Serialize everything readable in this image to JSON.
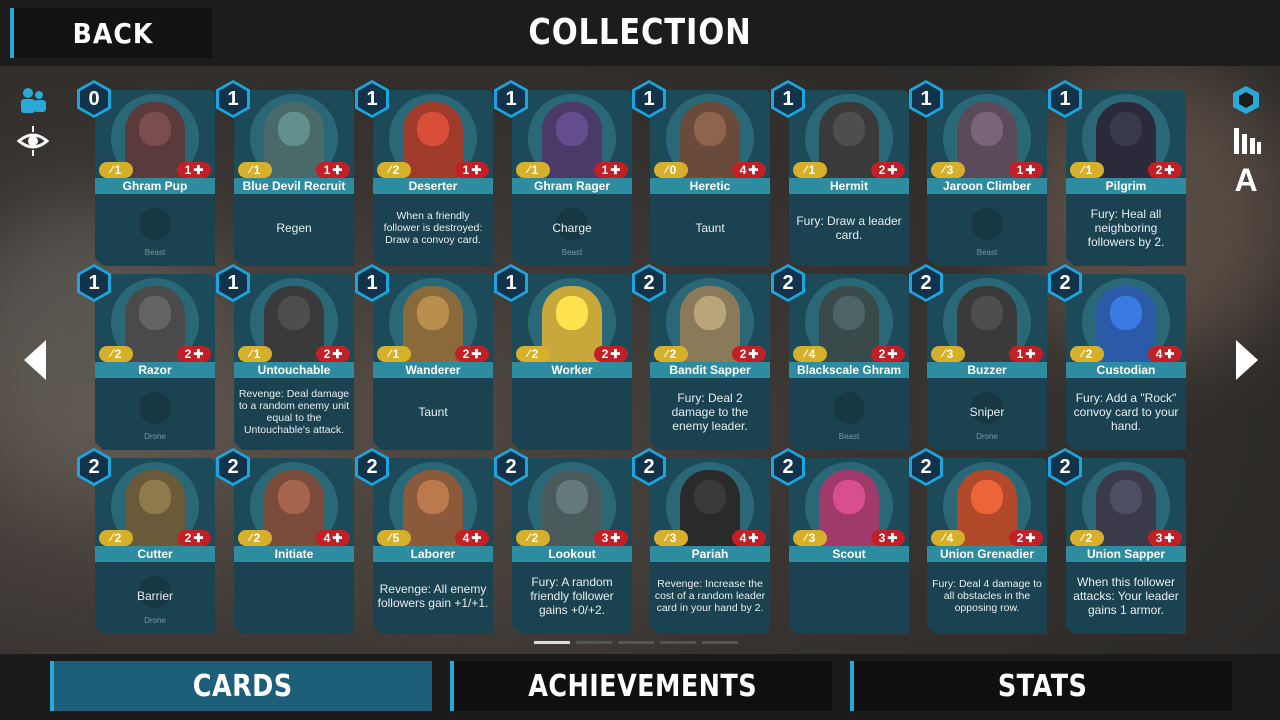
{
  "header": {
    "back_label": "BACK",
    "title": "COLLECTION"
  },
  "sidebar_left": {
    "icons": [
      "people-icon",
      "eye-target-icon"
    ]
  },
  "sidebar_right": {
    "icons": [
      "hexagon-icon",
      "bars-icon",
      "letter-a-icon"
    ],
    "letter_a": "A"
  },
  "cards": [
    {
      "name": "Ghram Pup",
      "cost": "0",
      "attack": "1",
      "health": "1",
      "text": "",
      "tag": "Beast",
      "art": "#5a3a3a"
    },
    {
      "name": "Blue Devil Recruit",
      "cost": "1",
      "attack": "1",
      "health": "1",
      "text": "Regen",
      "tag": "",
      "art": "#4a6a6a"
    },
    {
      "name": "Deserter",
      "cost": "1",
      "attack": "2",
      "health": "1",
      "text": "When a friendly follower is destroyed: Draw a convoy card.",
      "tag": "",
      "art": "#a03a2a"
    },
    {
      "name": "Ghram Rager",
      "cost": "1",
      "attack": "1",
      "health": "1",
      "text": "Charge",
      "tag": "Beast",
      "art": "#4a3a6a"
    },
    {
      "name": "Heretic",
      "cost": "1",
      "attack": "0",
      "health": "4",
      "text": "Taunt",
      "tag": "",
      "art": "#6a4a3a"
    },
    {
      "name": "Hermit",
      "cost": "1",
      "attack": "1",
      "health": "2",
      "text": "Fury: Draw a leader card.",
      "tag": "",
      "art": "#3a3a3a"
    },
    {
      "name": "Jaroon Climber",
      "cost": "1",
      "attack": "3",
      "health": "1",
      "text": "",
      "tag": "Beast",
      "art": "#5a4a5a"
    },
    {
      "name": "Pilgrim",
      "cost": "1",
      "attack": "1",
      "health": "2",
      "text": "Fury: Heal all neighboring followers by 2.",
      "tag": "",
      "art": "#2a2a3a"
    },
    {
      "name": "Razor",
      "cost": "1",
      "attack": "2",
      "health": "2",
      "text": "",
      "tag": "Drone",
      "art": "#4a4a4a"
    },
    {
      "name": "Untouchable",
      "cost": "1",
      "attack": "1",
      "health": "2",
      "text": "Revenge: Deal damage to a random enemy unit equal to the Untouchable's attack.",
      "tag": "",
      "art": "#3a3a3a"
    },
    {
      "name": "Wanderer",
      "cost": "1",
      "attack": "1",
      "health": "2",
      "text": "Taunt",
      "tag": "",
      "art": "#8a6a3a"
    },
    {
      "name": "Worker",
      "cost": "1",
      "attack": "2",
      "health": "2",
      "text": "",
      "tag": "",
      "art": "#c8a83a"
    },
    {
      "name": "Bandit Sapper",
      "cost": "2",
      "attack": "2",
      "health": "2",
      "text": "Fury: Deal 2 damage to the enemy leader.",
      "tag": "",
      "art": "#8a7a5a"
    },
    {
      "name": "Blackscale Ghram",
      "cost": "2",
      "attack": "4",
      "health": "2",
      "text": "",
      "tag": "Beast",
      "art": "#3a4a4a"
    },
    {
      "name": "Buzzer",
      "cost": "2",
      "attack": "3",
      "health": "1",
      "text": "Sniper",
      "tag": "Drone",
      "art": "#3a3a3a"
    },
    {
      "name": "Custodian",
      "cost": "2",
      "attack": "2",
      "health": "4",
      "text": "Fury: Add a \"Rock\" convoy card to your hand.",
      "tag": "",
      "art": "#2a5aa8"
    },
    {
      "name": "Cutter",
      "cost": "2",
      "attack": "2",
      "health": "2",
      "text": "Barrier",
      "tag": "Drone",
      "art": "#6a5a3a"
    },
    {
      "name": "Initiate",
      "cost": "2",
      "attack": "2",
      "health": "4",
      "text": "",
      "tag": "",
      "art": "#7a4a3a"
    },
    {
      "name": "Laborer",
      "cost": "2",
      "attack": "5",
      "health": "4",
      "text": "Revenge: All enemy followers gain +1/+1.",
      "tag": "",
      "art": "#8a5a3a"
    },
    {
      "name": "Lookout",
      "cost": "2",
      "attack": "2",
      "health": "3",
      "text": "Fury: A random friendly follower gains +0/+2.",
      "tag": "",
      "art": "#4a5a5a"
    },
    {
      "name": "Pariah",
      "cost": "2",
      "attack": "3",
      "health": "4",
      "text": "Revenge: Increase the cost of a random leader card in your hand by 2.",
      "tag": "",
      "art": "#2a2a2a"
    },
    {
      "name": "Scout",
      "cost": "2",
      "attack": "3",
      "health": "3",
      "text": "",
      "tag": "",
      "art": "#a03a6a"
    },
    {
      "name": "Union Grenadier",
      "cost": "2",
      "attack": "4",
      "health": "2",
      "text": "Fury: Deal 4 damage to all obstacles in the opposing row.",
      "tag": "",
      "art": "#b04a2a"
    },
    {
      "name": "Union Sapper",
      "cost": "2",
      "attack": "2",
      "health": "3",
      "text": "When this follower attacks: Your leader gains 1 armor.",
      "tag": "",
      "art": "#3a3a4a"
    }
  ],
  "pagination": {
    "pages": 5,
    "current": 1
  },
  "tabs": [
    {
      "label": "CARDS",
      "active": true
    },
    {
      "label": "ACHIEVEMENTS",
      "active": false
    },
    {
      "label": "STATS",
      "active": false
    }
  ],
  "colors": {
    "accent": "#2aa8d8",
    "attack": "#d6b02a",
    "health": "#c21f26",
    "name_bar": "#2e8ca0"
  }
}
